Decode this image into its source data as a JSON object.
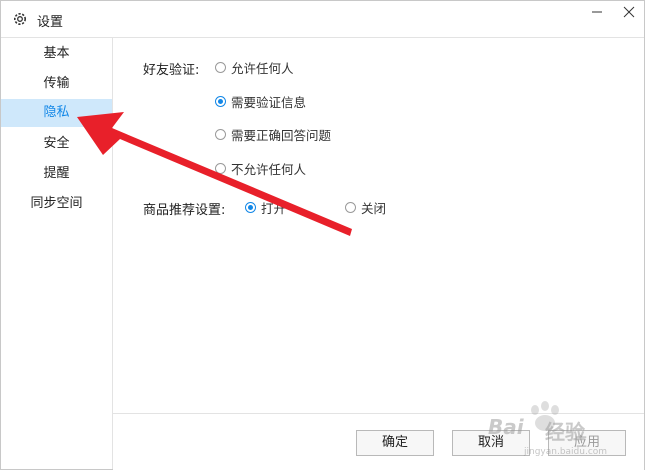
{
  "window": {
    "title": "设置"
  },
  "sidebar": {
    "items": [
      {
        "label": "基本"
      },
      {
        "label": "传输"
      },
      {
        "label": "隐私",
        "active": true
      },
      {
        "label": "安全"
      },
      {
        "label": "提醒"
      },
      {
        "label": "同步空间"
      }
    ]
  },
  "privacy": {
    "friend_verify_label": "好友验证:",
    "friend_verify_options": [
      {
        "label": "允许任何人",
        "checked": false
      },
      {
        "label": "需要验证信息",
        "checked": true
      },
      {
        "label": "需要正确回答问题",
        "checked": false
      },
      {
        "label": "不允许任何人",
        "checked": false
      }
    ],
    "product_recommend_label": "商品推荐设置:",
    "product_recommend_options": [
      {
        "label": "打开",
        "checked": true
      },
      {
        "label": "关闭",
        "checked": false
      }
    ]
  },
  "footer": {
    "ok_label": "确定",
    "cancel_label": "取消",
    "apply_label": "应用"
  },
  "watermark": {
    "logo": "Bai",
    "text": "经验",
    "sub": "jingyan.baidu.com"
  },
  "colors": {
    "accent": "#1287e7",
    "active_bg": "#cfe8fb",
    "arrow": "#e8202a"
  }
}
